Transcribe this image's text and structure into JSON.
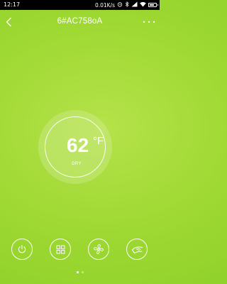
{
  "status_bar": {
    "time": "12:17",
    "network_speed": "0.01K/s",
    "battery_level": 0.7
  },
  "header": {
    "title": "6#AC758oA"
  },
  "thermostat": {
    "temperature": "62",
    "unit": "°F",
    "mode": "DRY"
  },
  "controls": [
    {
      "icon": "power-icon"
    },
    {
      "icon": "mode-grid-icon"
    },
    {
      "icon": "fan-icon"
    },
    {
      "icon": "swing-icon"
    }
  ],
  "pagination": {
    "current_page": 1,
    "page_count": 2
  },
  "colors": {
    "background": "#9ed832",
    "foreground": "#ffffff"
  }
}
